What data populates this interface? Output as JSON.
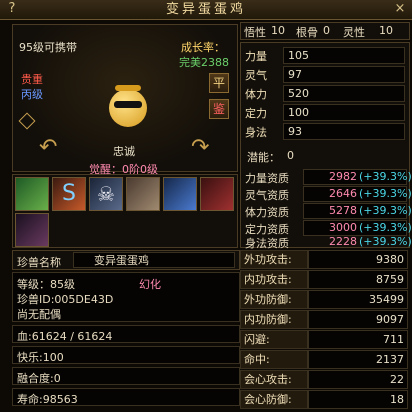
{
  "window": {
    "title": "变异蛋蛋鸡"
  },
  "top_stats": {
    "wuxing_label": "悟性",
    "wuxing": "10",
    "gengu_label": "根骨",
    "gengu": "0",
    "lingxing_label": "灵性",
    "lingxing": "10"
  },
  "pet": {
    "level_text": "95级可携带",
    "growth_label": "成长率：",
    "growth_value": "完美2388",
    "type1": "贵重",
    "type2": "丙级",
    "loyalty": "忠诚",
    "awaken": "觉醒：0阶0级",
    "btn_ping": "平",
    "btn_jian": "鉴"
  },
  "attributes": [
    {
      "label": "力量",
      "value": "105"
    },
    {
      "label": "灵气",
      "value": "97"
    },
    {
      "label": "体力",
      "value": "520"
    },
    {
      "label": "定力",
      "value": "100"
    },
    {
      "label": "身法",
      "value": "93"
    }
  ],
  "potential": {
    "label": "潜能：",
    "value": "0"
  },
  "aptitudes": [
    {
      "label": "力量资质",
      "value": "2982",
      "bonus": "(+39.3%)"
    },
    {
      "label": "灵气资质",
      "value": "2646",
      "bonus": "(+39.3%)"
    },
    {
      "label": "体力资质",
      "value": "5278",
      "bonus": "(+39.3%)"
    },
    {
      "label": "定力资质",
      "value": "3000",
      "bonus": "(+39.3%)"
    },
    {
      "label": "身法资质",
      "value": "2228",
      "bonus": "(+39.3%)"
    }
  ],
  "skills": [
    {
      "icon": "green-leaf-skill-icon",
      "color": "#2f7d3a"
    },
    {
      "icon": "snake-skill-icon",
      "color": "#a84a2a"
    },
    {
      "icon": "skull-skill-icon",
      "color": "#3a4a6a"
    },
    {
      "icon": "ear-skill-icon",
      "color": "#6a5a4a"
    },
    {
      "icon": "blue-flame-skill-icon",
      "color": "#2a4a7a"
    },
    {
      "icon": "red-warrior-skill-icon",
      "color": "#6a2020"
    },
    {
      "icon": "dark-warrior-skill-icon",
      "color": "#3a2a40"
    }
  ],
  "name_field": {
    "label": "珍兽名称",
    "value": "变异蛋蛋鸡"
  },
  "info": {
    "level": "等级：85级",
    "huanhua": "幻化",
    "id": "珍兽ID:005DE43D",
    "mate": "尚无配偶"
  },
  "bottom_stats": [
    {
      "label": "血:61624 / 61624"
    },
    {
      "label": "快乐:100"
    },
    {
      "label": "融合度:0"
    },
    {
      "label": "寿命:98563"
    }
  ],
  "combat": [
    {
      "label": "外功攻击:",
      "value": "9380"
    },
    {
      "label": "内功攻击:",
      "value": "8759"
    },
    {
      "label": "外功防御:",
      "value": "35499"
    },
    {
      "label": "内功防御:",
      "value": "9097"
    },
    {
      "label": "闪避:",
      "value": "711"
    },
    {
      "label": "命中:",
      "value": "2137"
    },
    {
      "label": "会心攻击:",
      "value": "22"
    },
    {
      "label": "会心防御:",
      "value": "18"
    }
  ]
}
